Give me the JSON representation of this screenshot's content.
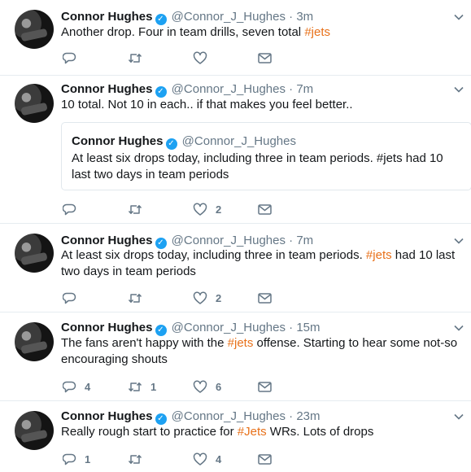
{
  "author": {
    "name": "Connor Hughes",
    "handle": "@Connor_J_Hughes",
    "verified_glyph": "✓"
  },
  "accent_color": "#e8711a",
  "icons": [
    "reply-icon",
    "retweet-icon",
    "like-icon",
    "message-icon",
    "chevron-down-icon",
    "verified-badge-icon"
  ],
  "tweets": [
    {
      "time": "3m",
      "text_parts": [
        "Another drop. Four in team drills, seven total ",
        "#jets",
        ""
      ],
      "replies": "",
      "retweets": "",
      "likes": ""
    },
    {
      "time": "7m",
      "text_parts": [
        "10 total. Not 10 in each.. if that makes you feel better..",
        "",
        ""
      ],
      "quote": {
        "name": "Connor Hughes",
        "handle": "@Connor_J_Hughes",
        "text": "At least six drops today, including three in team periods. #jets had 10 last two days in team periods"
      },
      "replies": "",
      "retweets": "",
      "likes": "2"
    },
    {
      "time": "7m",
      "text_parts": [
        "At least six drops today, including three in team periods. ",
        "#jets",
        " had 10 last two days in team periods"
      ],
      "replies": "",
      "retweets": "",
      "likes": "2"
    },
    {
      "time": "15m",
      "text_parts": [
        "The fans aren't happy with the ",
        "#jets",
        " offense. Starting to hear some not-so encouraging shouts"
      ],
      "replies": "4",
      "retweets": "1",
      "likes": "6"
    },
    {
      "time": "23m",
      "text_parts": [
        "Really rough start to practice for ",
        "#Jets",
        " WRs. Lots of drops"
      ],
      "replies": "1",
      "retweets": "",
      "likes": "4"
    }
  ]
}
